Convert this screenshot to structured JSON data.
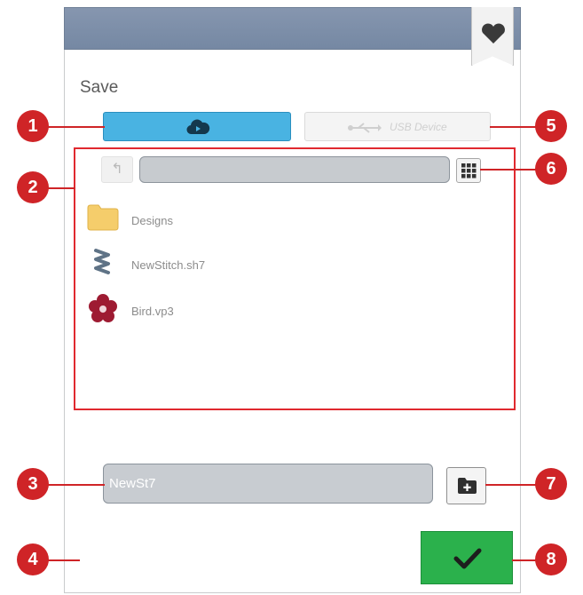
{
  "dialog": {
    "title": "Save",
    "favorite_icon": "heart-icon"
  },
  "sources": {
    "cloud_icon": "cloud-icon",
    "usb_label": "USB Device",
    "usb_icon": "usb-icon"
  },
  "browser": {
    "up_icon": "folder-up-icon",
    "path": "",
    "view_icon": "grid-view-icon",
    "items": [
      {
        "name": "Designs",
        "icon": "folder-icon"
      },
      {
        "name": "NewStitch.sh7",
        "icon": "stitch-file-icon"
      },
      {
        "name": "Bird.vp3",
        "icon": "embroidery-flower-icon"
      }
    ]
  },
  "save": {
    "filename": "NewSt7",
    "new_folder_icon": "new-folder-icon",
    "confirm_icon": "checkmark-icon"
  },
  "callouts": [
    "1",
    "2",
    "3",
    "4",
    "5",
    "6",
    "7",
    "8"
  ],
  "colors": {
    "header": "#7e8fa9",
    "cloud_button": "#49b3e2",
    "confirm_button": "#2bb14c",
    "callout": "#cf2427",
    "highlight_border": "#e0292f",
    "folder": "#f5cd6b",
    "flower": "#9e1b32"
  }
}
